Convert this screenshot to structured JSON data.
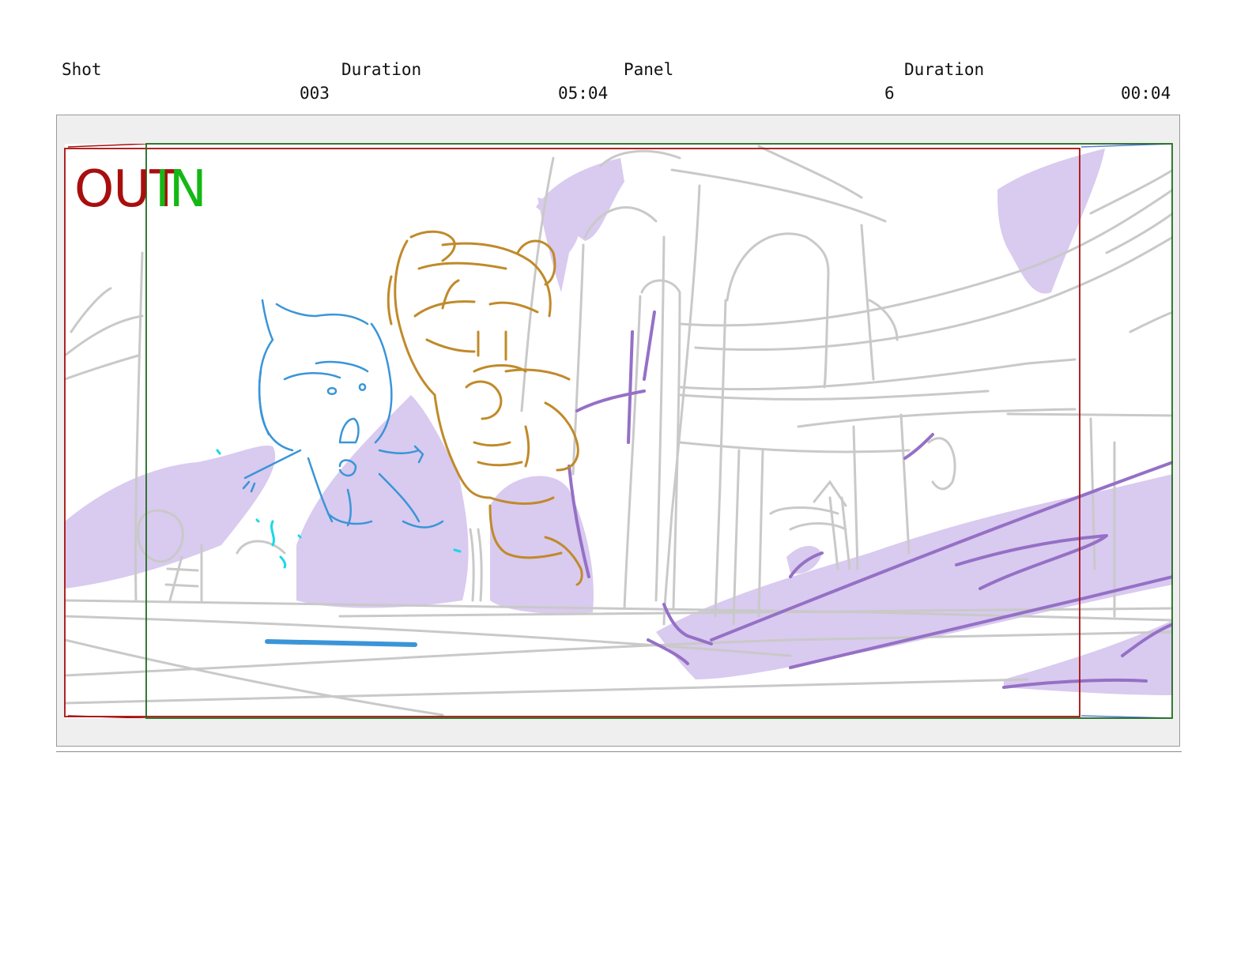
{
  "header": {
    "shot_label": "Shot",
    "shot_duration_label": "Duration",
    "panel_label": "Panel",
    "panel_duration_label": "Duration",
    "shot_value": "003",
    "shot_duration_value": "05:04",
    "panel_value": "6",
    "panel_duration_value": "00:04"
  },
  "panel": {
    "out_mark": "OUT",
    "in_mark": "IN"
  },
  "colors": {
    "out_frame": "#a80e0e",
    "in_frame": "#1d6b1d",
    "in_text": "#14b814",
    "sketch_gray": "#c8c8c8",
    "purple_fill": "#d7c8ec",
    "purple_line": "#9570c6",
    "blue_character": "#3a95d8",
    "gold_character": "#c08a2a",
    "cyan_effect": "#19d8e8"
  }
}
